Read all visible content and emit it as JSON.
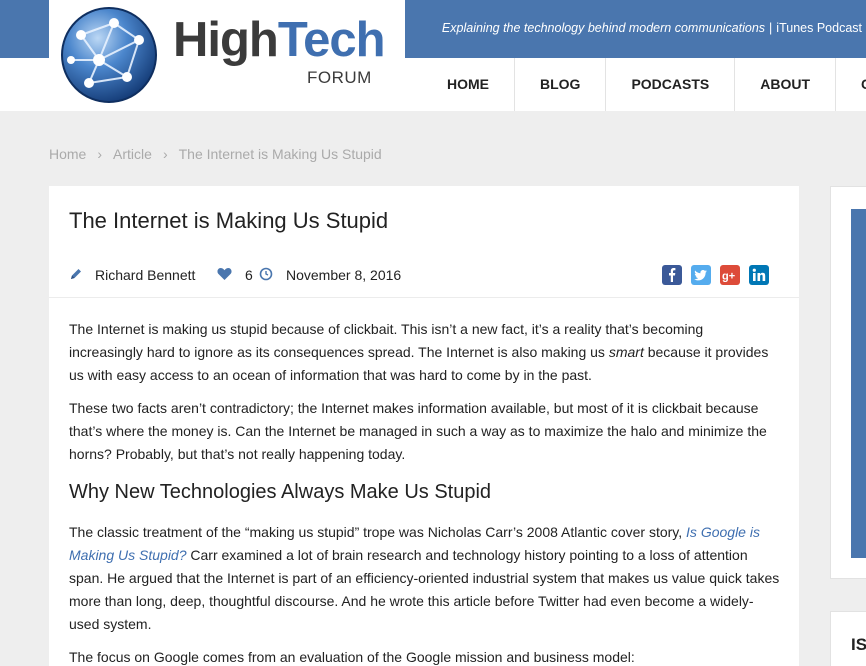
{
  "site": {
    "brand_high": "High",
    "brand_tech": "Tech",
    "brand_sub": "FORUM",
    "tagline": "Explaining the technology behind modern communications",
    "tagline_link": "iTunes Podcast",
    "tagline_sep": "|",
    "accent_color": "#4a76ae"
  },
  "nav": {
    "items": [
      {
        "label": "HOME"
      },
      {
        "label": "BLOG"
      },
      {
        "label": "PODCASTS"
      },
      {
        "label": "ABOUT"
      },
      {
        "label": "C"
      }
    ]
  },
  "breadcrumb": {
    "items": [
      "Home",
      "Article",
      "The Internet is Making Us Stupid"
    ],
    "separator": "›"
  },
  "article": {
    "title": "The Internet is Making Us Stupid",
    "author": "Richard Bennett",
    "likes": "6",
    "date": "November 8, 2016",
    "social": [
      {
        "icon": "facebook-icon",
        "color": "#3b5998"
      },
      {
        "icon": "twitter-icon",
        "color": "#55acee"
      },
      {
        "icon": "google-plus-icon",
        "color": "#dd4b39"
      },
      {
        "icon": "linkedin-icon",
        "color": "#0077b5"
      }
    ],
    "p1_a": "The Internet is making us stupid because of clickbait. This isn’t a new fact, it’s a reality that’s becoming increasingly hard to ignore as its consequences spread. The Internet is also making us ",
    "p1_em": "smart",
    "p1_b": " because it provides us with easy access to an ocean of information that was hard to come by in the past.",
    "p2": "These two facts aren’t contradictory; the Internet makes information available, but most of it is clickbait because that’s where the money is. Can the Internet be managed in such a way as to maximize the halo and minimize the horns? Probably, but that’s not really happening today.",
    "h2": "Why New Technologies Always Make Us Stupid",
    "p3_a": "The classic treatment of the “making us stupid” trope was Nicholas Carr’s 2008 Atlantic cover story, ",
    "p3_link": "Is Google is Making Us Stupid?",
    "p3_b": " Carr examined a lot of brain research and technology history pointing to a loss of attention span. He argued that the Internet is part of an efficiency-oriented industrial system that makes us value quick takes more than long, deep, thoughtful discourse. And he wrote this article before Twitter had even become a widely-used system.",
    "p4": "The focus on Google comes from an evaluation of the Google mission and business model:"
  },
  "sidebar": {
    "label": "IS"
  }
}
